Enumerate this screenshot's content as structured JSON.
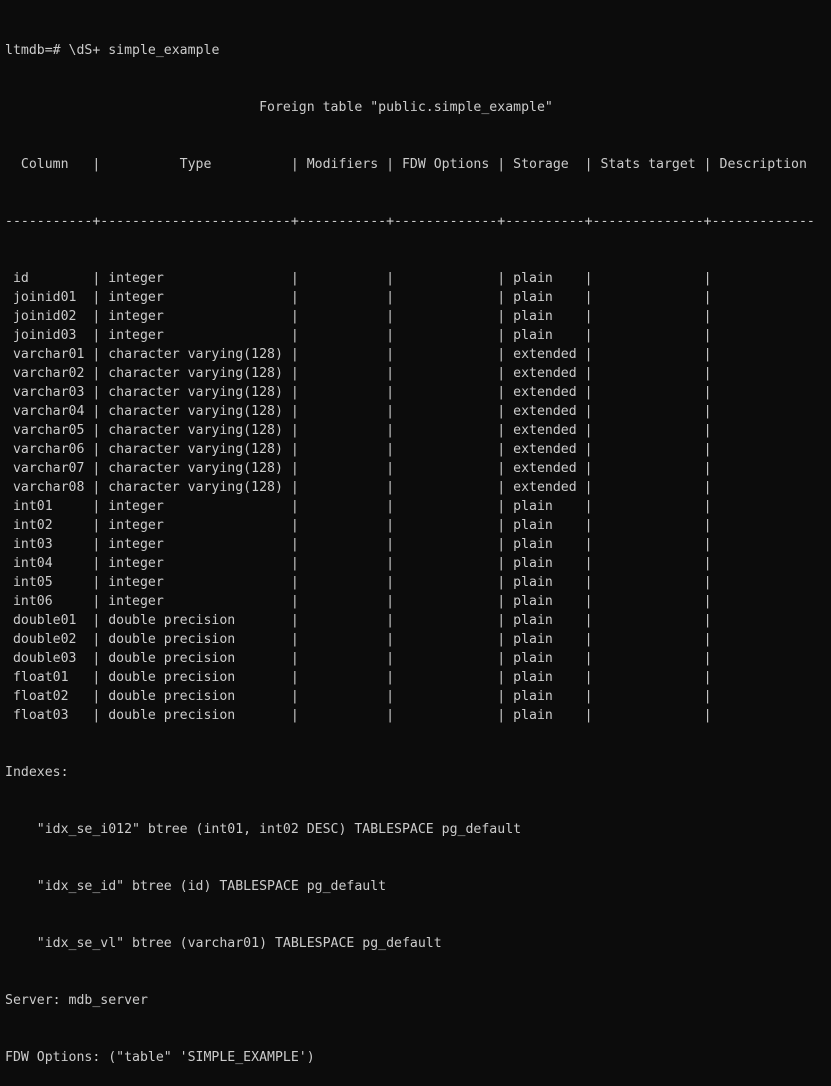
{
  "prompt": "ltmdb=# ",
  "command": "\\dS+ simple_example",
  "table_title": "Foreign table \"public.simple_example\"",
  "headers": [
    "Column",
    "Type",
    "Modifiers",
    "FDW Options",
    "Storage",
    "Stats target",
    "Description"
  ],
  "rows": [
    {
      "column": "id",
      "type": "integer",
      "storage": "plain"
    },
    {
      "column": "joinid01",
      "type": "integer",
      "storage": "plain"
    },
    {
      "column": "joinid02",
      "type": "integer",
      "storage": "plain"
    },
    {
      "column": "joinid03",
      "type": "integer",
      "storage": "plain"
    },
    {
      "column": "varchar01",
      "type": "character varying(128)",
      "storage": "extended"
    },
    {
      "column": "varchar02",
      "type": "character varying(128)",
      "storage": "extended"
    },
    {
      "column": "varchar03",
      "type": "character varying(128)",
      "storage": "extended"
    },
    {
      "column": "varchar04",
      "type": "character varying(128)",
      "storage": "extended"
    },
    {
      "column": "varchar05",
      "type": "character varying(128)",
      "storage": "extended"
    },
    {
      "column": "varchar06",
      "type": "character varying(128)",
      "storage": "extended"
    },
    {
      "column": "varchar07",
      "type": "character varying(128)",
      "storage": "extended"
    },
    {
      "column": "varchar08",
      "type": "character varying(128)",
      "storage": "extended"
    },
    {
      "column": "int01",
      "type": "integer",
      "storage": "plain"
    },
    {
      "column": "int02",
      "type": "integer",
      "storage": "plain"
    },
    {
      "column": "int03",
      "type": "integer",
      "storage": "plain"
    },
    {
      "column": "int04",
      "type": "integer",
      "storage": "plain"
    },
    {
      "column": "int05",
      "type": "integer",
      "storage": "plain"
    },
    {
      "column": "int06",
      "type": "integer",
      "storage": "plain"
    },
    {
      "column": "double01",
      "type": "double precision",
      "storage": "plain"
    },
    {
      "column": "double02",
      "type": "double precision",
      "storage": "plain"
    },
    {
      "column": "double03",
      "type": "double precision",
      "storage": "plain"
    },
    {
      "column": "float01",
      "type": "double precision",
      "storage": "plain"
    },
    {
      "column": "float02",
      "type": "double precision",
      "storage": "plain"
    },
    {
      "column": "float03",
      "type": "double precision",
      "storage": "plain"
    }
  ],
  "indexes_label": "Indexes:",
  "indexes": [
    "    \"idx_se_i012\" btree (int01, int02 DESC) TABLESPACE pg_default",
    "    \"idx_se_id\" btree (id) TABLESPACE pg_default",
    "    \"idx_se_vl\" btree (varchar01) TABLESPACE pg_default"
  ],
  "server_line": "Server: mdb_server",
  "fdw_options_line": "FDW Options: (\"table\" 'SIMPLE_EXAMPLE')"
}
